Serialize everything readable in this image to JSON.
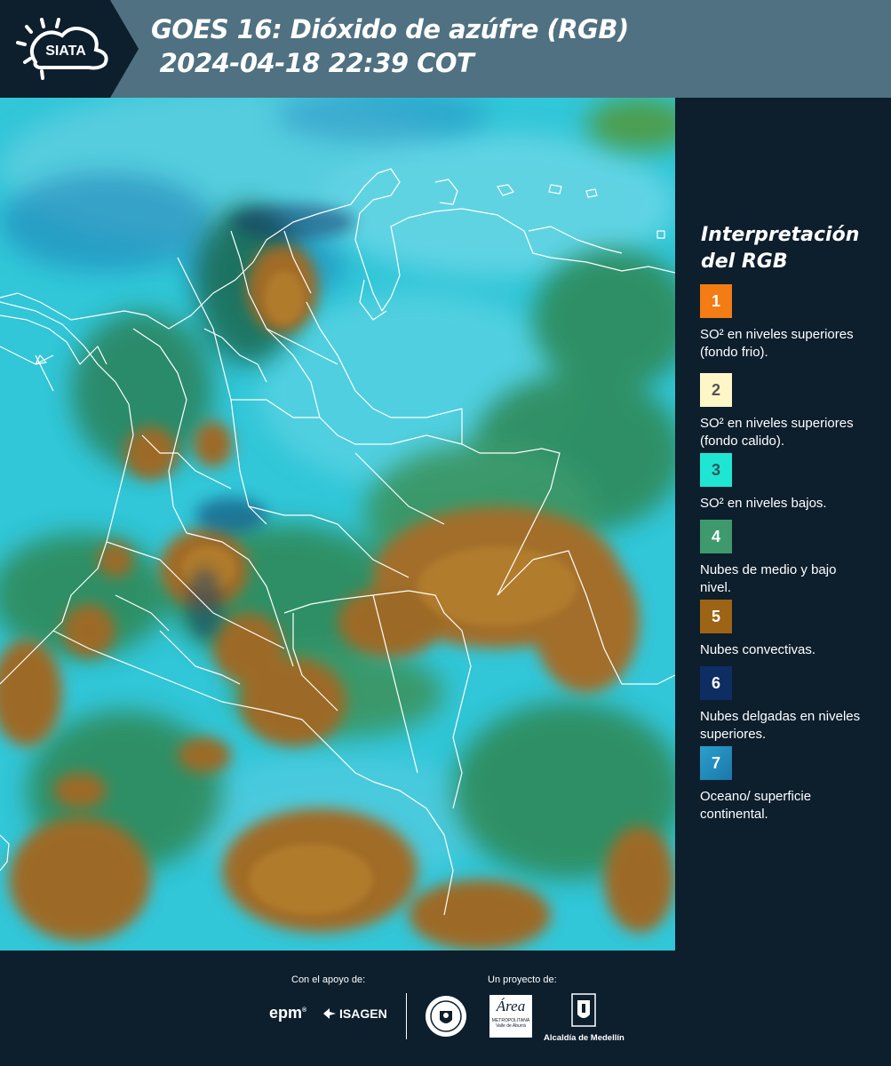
{
  "header": {
    "logo_text": "SIATA",
    "title_line1": "GOES 16: Dióxido de azúfre (RGB)",
    "title_line2": " 2024-04-18 22:39 COT",
    "bg_color": "#4f7181"
  },
  "legend": {
    "title": "Interpretación del RGB",
    "items": [
      {
        "num": "1",
        "color": "#f47c14",
        "num_color": "#ffffff",
        "text": "SO² en niveles superiores (fondo frio)."
      },
      {
        "num": "2",
        "color": "#fff6c8",
        "num_color": "#555555",
        "text": "SO² en niveles superiores (fondo calido)."
      },
      {
        "num": "3",
        "color": "#1ee6d2",
        "num_color": "#2b5a5a",
        "text": "SO² en niveles bajos."
      },
      {
        "num": "4",
        "color": "#3e9a6c",
        "num_color": "#ffffff",
        "text": "Nubes de medio y bajo nivel."
      },
      {
        "num": "5",
        "color": "#9c6414",
        "num_color": "#ffffff",
        "text": "Nubes convectivas."
      },
      {
        "num": "6",
        "color": "#0e2d62",
        "num_color": "#ffffff",
        "text": "Nubes delgadas en niveles superiores."
      },
      {
        "num": "7",
        "color": "#1e8fbb",
        "num_color": "#ffffff",
        "text": "Oceano/ superficie continental."
      }
    ]
  },
  "footer": {
    "support_label": "Con el apoyo de:",
    "project_label": "Un proyecto de:",
    "sponsors": [
      "epm",
      "ISAGEN"
    ],
    "partners": [
      "Área Metropolitana Valle de Aburrá",
      "Alcaldía de Medellín"
    ],
    "area_logo_text": "Área",
    "area_logo_sub": "METROPOLITANA",
    "area_logo_sub2": "Valle de Aburrá",
    "alcaldia_text": "Alcaldía de Medellín"
  },
  "map": {
    "image": "goes16-so2-rgb-colombia",
    "colors": {
      "ocean_cyan": "#2bc4da",
      "cloud_brown": "#9c6a28",
      "cloud_green": "#2f8a5a",
      "border": "#ffffff"
    }
  }
}
